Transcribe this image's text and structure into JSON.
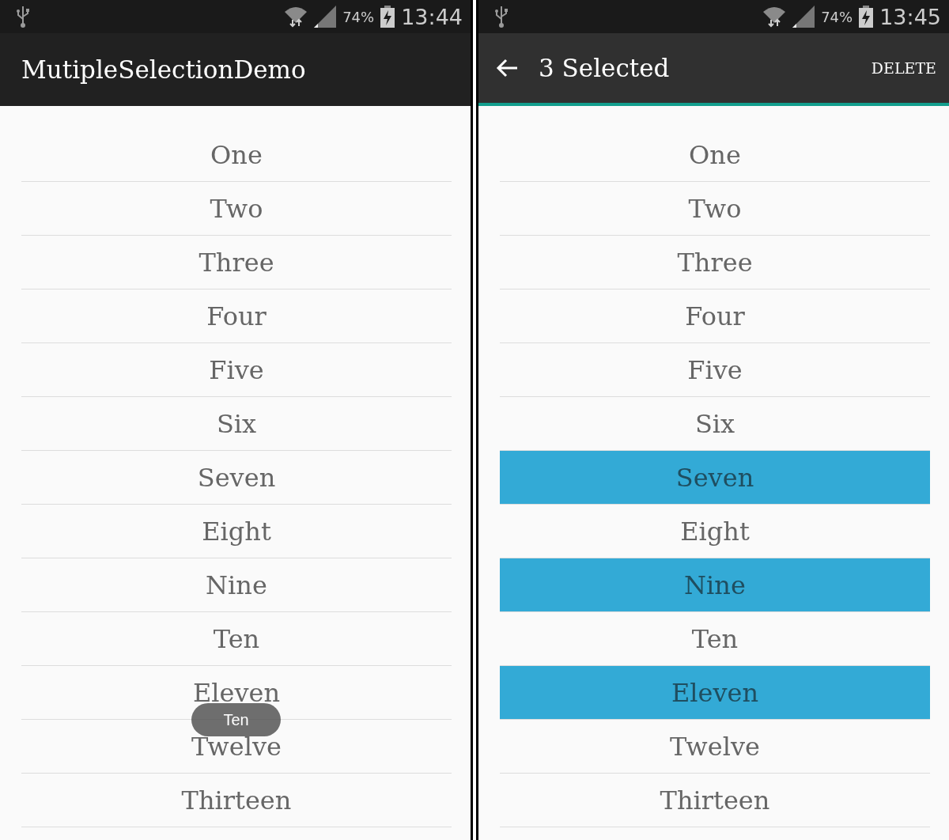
{
  "screens": [
    {
      "status_bar": {
        "battery": "74%",
        "time": "13:44"
      },
      "toolbar": {
        "kind": "title",
        "title": "MutipleSelectionDemo"
      },
      "items": [
        {
          "label": "One",
          "selected": false
        },
        {
          "label": "Two",
          "selected": false
        },
        {
          "label": "Three",
          "selected": false
        },
        {
          "label": "Four",
          "selected": false
        },
        {
          "label": "Five",
          "selected": false
        },
        {
          "label": "Six",
          "selected": false
        },
        {
          "label": "Seven",
          "selected": false
        },
        {
          "label": "Eight",
          "selected": false
        },
        {
          "label": "Nine",
          "selected": false
        },
        {
          "label": "Ten",
          "selected": false
        },
        {
          "label": "Eleven",
          "selected": false
        },
        {
          "label": "Twelve",
          "selected": false
        },
        {
          "label": "Thirteen",
          "selected": false
        }
      ],
      "toast": "Ten"
    },
    {
      "status_bar": {
        "battery": "74%",
        "time": "13:45"
      },
      "toolbar": {
        "kind": "action_mode",
        "title": "3 Selected",
        "action": "DELETE"
      },
      "items": [
        {
          "label": "One",
          "selected": false
        },
        {
          "label": "Two",
          "selected": false
        },
        {
          "label": "Three",
          "selected": false
        },
        {
          "label": "Four",
          "selected": false
        },
        {
          "label": "Five",
          "selected": false
        },
        {
          "label": "Six",
          "selected": false
        },
        {
          "label": "Seven",
          "selected": true
        },
        {
          "label": "Eight",
          "selected": false
        },
        {
          "label": "Nine",
          "selected": true
        },
        {
          "label": "Ten",
          "selected": false
        },
        {
          "label": "Eleven",
          "selected": true
        },
        {
          "label": "Twelve",
          "selected": false
        },
        {
          "label": "Thirteen",
          "selected": false
        }
      ]
    }
  ]
}
